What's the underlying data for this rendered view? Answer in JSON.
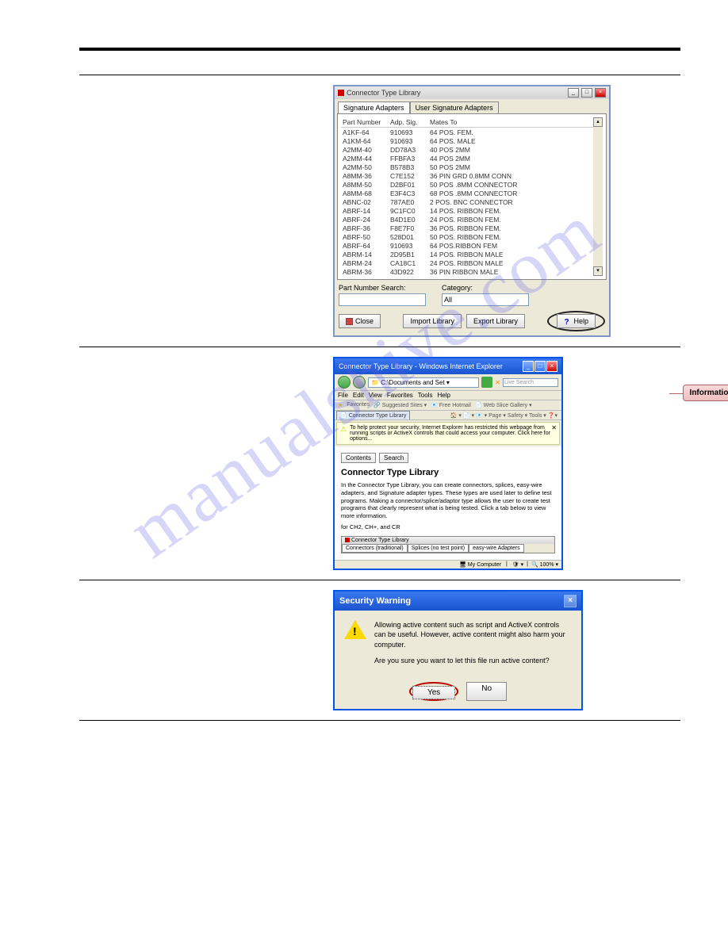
{
  "watermark": "manualshive.com",
  "connector_library": {
    "title": "Connector Type Library",
    "tabs": [
      "Signature Adapters",
      "User Signature Adapters"
    ],
    "columns": [
      "Part Number",
      "Adp. Sig.",
      "Mates To"
    ],
    "rows": [
      {
        "pn": "A1KF-64",
        "sig": "910693",
        "mate": "64 POS. FEM."
      },
      {
        "pn": "A1KM-64",
        "sig": "910693",
        "mate": "64 POS. MALE"
      },
      {
        "pn": "A2MM-40",
        "sig": "DD78A3",
        "mate": "40 POS 2MM"
      },
      {
        "pn": "A2MM-44",
        "sig": "FFBFA3",
        "mate": "44 POS 2MM"
      },
      {
        "pn": "A2MM-50",
        "sig": "B578B3",
        "mate": "50 POS 2MM"
      },
      {
        "pn": "A8MM-36",
        "sig": "C7E152",
        "mate": "36 PIN GRD 0.8MM CONN"
      },
      {
        "pn": "A8MM-50",
        "sig": "D2BF01",
        "mate": "50 POS .8MM CONNECTOR"
      },
      {
        "pn": "A8MM-68",
        "sig": "E3F4C3",
        "mate": "68 POS .8MM CONNECTOR"
      },
      {
        "pn": "ABNC-02",
        "sig": "787AE0",
        "mate": "2 POS. BNC CONNECTOR"
      },
      {
        "pn": "ABRF-14",
        "sig": "9C1FC0",
        "mate": "14 POS. RIBBON FEM."
      },
      {
        "pn": "ABRF-24",
        "sig": "B4D1E0",
        "mate": "24 POS. RIBBON FEM."
      },
      {
        "pn": "ABRF-36",
        "sig": "F8E7F0",
        "mate": "36 POS. RIBBON FEM."
      },
      {
        "pn": "ABRF-50",
        "sig": "528D01",
        "mate": "50 POS. RIBBON FEM."
      },
      {
        "pn": "ABRF-64",
        "sig": "910693",
        "mate": "64 POS.RIBBON FEM"
      },
      {
        "pn": "ABRM-14",
        "sig": "2D95B1",
        "mate": "14 POS. RIBBON MALE"
      },
      {
        "pn": "ABRM-24",
        "sig": "CA18C1",
        "mate": "24 POS. RIBBON MALE"
      },
      {
        "pn": "ABRM-36",
        "sig": "43D922",
        "mate": "36 PIN RIBBON MALE"
      }
    ],
    "search_label": "Part Number Search:",
    "category_label": "Category:",
    "category_value": "All",
    "btn_close": "Close",
    "btn_import": "Import Library",
    "btn_export": "Export Library",
    "btn_help": "Help"
  },
  "ie_window": {
    "title": "Connector Type Library - Windows Internet Explorer",
    "address": "C:\\Documents and Set",
    "search_placeholder": "Live Search",
    "menus": [
      "File",
      "Edit",
      "View",
      "Favorites",
      "Tools",
      "Help"
    ],
    "favorites_label": "Favorites",
    "fav_items": [
      "Suggested Sites",
      "Free Hotmail",
      "Web Slice Gallery"
    ],
    "tab_label": "Connector Type Library",
    "cmd_items": "Page ▾  Safety ▾  Tools ▾",
    "infobar": "To help protect your security, Internet Explorer has restricted this webpage from running scripts or ActiveX controls that could access your computer. Click here for options...",
    "btn_contents": "Contents",
    "btn_search": "Search",
    "heading": "Connector Type Library",
    "body1": "In the Connector Type Library, you can create connectors, splices, easy-wire adapters, and Signature adapter types. These types are used later to define test programs. Making a connector/splice/adaptor type allows the user to create test programs that clearly represent what is being tested. Click a tab below to view more information.",
    "body2": "for CH2, CH+, and CR",
    "inner_title": "Connector Type Library",
    "inner_tabs": [
      "Connectors (traditional)",
      "Splices (no test point)",
      "easy-wire Adapters"
    ],
    "status_my_computer": "My Computer",
    "status_zoom": "100%",
    "callout": "Information Bar"
  },
  "security_warning": {
    "title": "Security Warning",
    "line1": "Allowing active content such as script and ActiveX controls can be useful. However, active content might also harm your computer.",
    "line2": "Are you sure you want to let this file run active content?",
    "btn_yes": "Yes",
    "btn_no": "No"
  }
}
